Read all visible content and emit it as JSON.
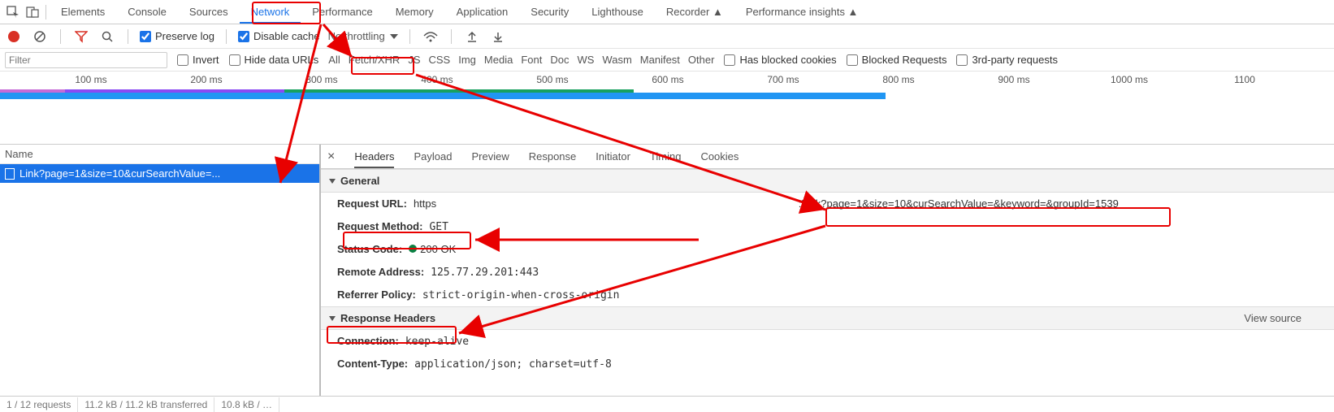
{
  "tabs": {
    "items": [
      "Elements",
      "Console",
      "Sources",
      "Network",
      "Performance",
      "Memory",
      "Application",
      "Security",
      "Lighthouse",
      "Recorder ▲",
      "Performance insights ▲"
    ],
    "activeIndex": 3
  },
  "toolbar": {
    "preserve_log": "Preserve log",
    "disable_cache": "Disable cache",
    "throttling": "No throttling"
  },
  "filter": {
    "placeholder": "Filter",
    "invert": "Invert",
    "hide_data_urls": "Hide data URLs",
    "types": [
      "All",
      "Fetch/XHR",
      "JS",
      "CSS",
      "Img",
      "Media",
      "Font",
      "Doc",
      "WS",
      "Wasm",
      "Manifest",
      "Other"
    ],
    "has_blocked": "Has blocked cookies",
    "blocked_requests": "Blocked Requests",
    "third_party": "3rd-party requests"
  },
  "timeline": {
    "ticks": [
      "100 ms",
      "200 ms",
      "300 ms",
      "400 ms",
      "500 ms",
      "600 ms",
      "700 ms",
      "800 ms",
      "900 ms",
      "1000 ms",
      "1100"
    ]
  },
  "left_panel": {
    "header": "Name",
    "request_name": "Link?page=1&size=10&curSearchValue=..."
  },
  "detail_tabs": [
    "Headers",
    "Payload",
    "Preview",
    "Response",
    "Initiator",
    "Timing",
    "Cookies"
  ],
  "sections": {
    "general": "General",
    "response_headers": "Response Headers",
    "view_source": "View source"
  },
  "general": {
    "request_url_k": "Request URL:",
    "request_url_v_prefix": "https",
    "request_url_v_suffix": ":Link?page=1&size=10&curSearchValue=&keyword=&groupId=1539",
    "request_method_k": "Request Method:",
    "request_method_v": "GET",
    "status_code_k": "Status Code:",
    "status_code_v": "200 OK",
    "remote_addr_k": "Remote Address:",
    "remote_addr_v": "125.77.29.201:443",
    "referrer_k": "Referrer Policy:",
    "referrer_v": "strict-origin-when-cross-origin"
  },
  "response_headers": {
    "connection_k": "Connection:",
    "connection_v": "keep-alive",
    "content_type_k": "Content-Type:",
    "content_type_v": "application/json; charset=utf-8"
  },
  "footer": {
    "requests": "1 / 12 requests",
    "transferred": "11.2 kB / 11.2 kB transferred",
    "resources": "10.8 kB / …"
  }
}
